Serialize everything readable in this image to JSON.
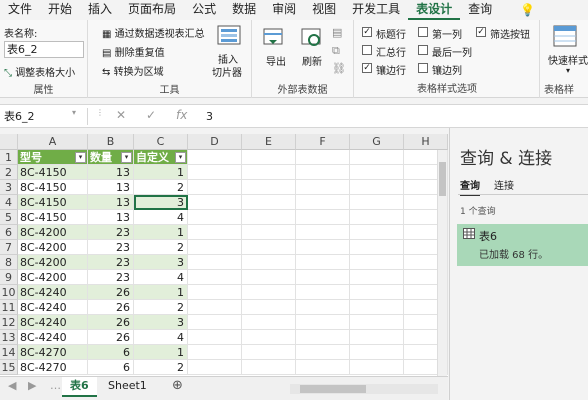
{
  "menu": [
    "文件",
    "开始",
    "插入",
    "页面布局",
    "公式",
    "数据",
    "审阅",
    "视图",
    "开发工具",
    "表设计",
    "查询"
  ],
  "menu_active": 9,
  "properties": {
    "name_label": "表名称:",
    "name_value": "表6_2",
    "resize_label": "调整表格大小",
    "group_label": "属性"
  },
  "tools": {
    "pivot_label": "通过数据透视表汇总",
    "dedupe_label": "删除重复值",
    "convert_label": "转换为区域",
    "slicer_line1": "插入",
    "slicer_line2": "切片器",
    "group_label": "工具"
  },
  "external": {
    "export_label": "导出",
    "refresh_label": "刷新",
    "group_label": "外部表数据"
  },
  "style_options": {
    "items": [
      {
        "label": "标题行",
        "checked": true
      },
      {
        "label": "第一列",
        "checked": false
      },
      {
        "label": "筛选按钮",
        "checked": true
      },
      {
        "label": "汇总行",
        "checked": false
      },
      {
        "label": "最后一列",
        "checked": false
      },
      {
        "label": "镶边行",
        "checked": true
      },
      {
        "label": "镶边列",
        "checked": false
      }
    ],
    "group_label": "表格样式选项"
  },
  "styles": {
    "quick_label": "快速样式",
    "group_label": "表格样"
  },
  "formula_bar": {
    "name_box": "表6_2",
    "cancel_icon": "✕",
    "confirm_icon": "✓",
    "fx": "fx",
    "value": "3"
  },
  "grid": {
    "columns": [
      "A",
      "B",
      "C",
      "D",
      "E",
      "F",
      "G",
      "H"
    ],
    "header_row": [
      "型号",
      "数量",
      "自定义"
    ],
    "rows": [
      [
        "8C-4150",
        "13",
        "1"
      ],
      [
        "8C-4150",
        "13",
        "2"
      ],
      [
        "8C-4150",
        "13",
        "3"
      ],
      [
        "8C-4150",
        "13",
        "4"
      ],
      [
        "8C-4200",
        "23",
        "1"
      ],
      [
        "8C-4200",
        "23",
        "2"
      ],
      [
        "8C-4200",
        "23",
        "3"
      ],
      [
        "8C-4200",
        "23",
        "4"
      ],
      [
        "8C-4240",
        "26",
        "1"
      ],
      [
        "8C-4240",
        "26",
        "2"
      ],
      [
        "8C-4240",
        "26",
        "3"
      ],
      [
        "8C-4240",
        "26",
        "4"
      ],
      [
        "8C-4270",
        "6",
        "1"
      ],
      [
        "8C-4270",
        "6",
        "2"
      ]
    ],
    "row_numbers": [
      "1",
      "2",
      "3",
      "4",
      "5",
      "6",
      "7",
      "8",
      "9",
      "10",
      "11",
      "12",
      "13",
      "14",
      "15"
    ]
  },
  "sheets": {
    "tabs": [
      "表6",
      "Sheet1"
    ],
    "active": 0,
    "add_icon": "⊕"
  },
  "pane": {
    "title": "查询 & 连接",
    "tab_query": "查询",
    "tab_connect": "连接",
    "count": "1 个查询",
    "query_name": "表6",
    "query_status": "已加载 68 行。"
  },
  "colors": {
    "accent": "#217346",
    "table_header": "#70ad47",
    "band": "#e2efda",
    "query_card": "#a9d8b8"
  }
}
